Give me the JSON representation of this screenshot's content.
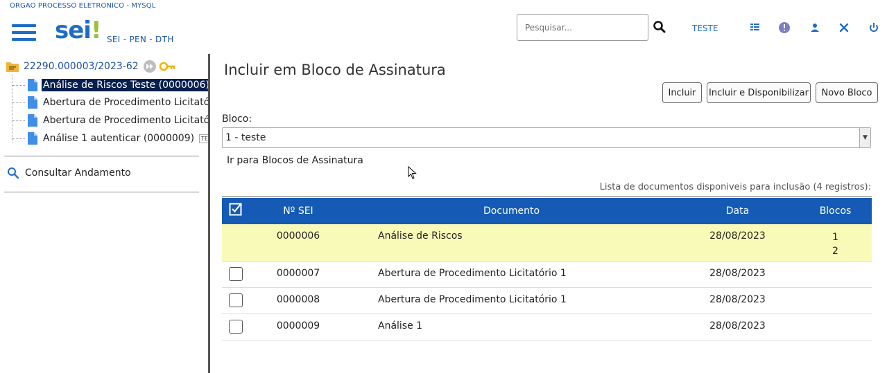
{
  "header": {
    "org_name": "ORGAO PROCESSO ELETRONICO - MYSQL",
    "logo_text": "sei",
    "logo_mark": "!",
    "system_name": "SEI - PEN - DTH",
    "search": {
      "placeholder": "Pesquisar...",
      "value": ""
    },
    "unit": "TESTE",
    "icons": [
      "search-icon",
      "list-icon",
      "info-icon",
      "user-icon",
      "tools-icon",
      "power-icon"
    ],
    "brand_color": "#1f6bc6"
  },
  "tree": {
    "process_number": "22290.000003/2023-62",
    "documents": [
      {
        "label": "Análise de Riscos Teste (0000006)",
        "selected": true,
        "tag": ""
      },
      {
        "label": "Abertura de Procedimento Licitatório",
        "selected": false,
        "tag": ""
      },
      {
        "label": "Abertura de Procedimento Licitatório",
        "selected": false,
        "tag": ""
      },
      {
        "label": "Análise 1 autenticar (0000009)",
        "selected": false,
        "tag": "TESTE"
      }
    ],
    "consult_label": "Consultar Andamento"
  },
  "main": {
    "title": "Incluir em Bloco de Assinatura",
    "buttons": {
      "incluir": "Incluir",
      "incluir_disponibilizar": "Incluir e Disponibilizar",
      "novo_bloco": "Novo Bloco"
    },
    "bloco_label": "Bloco:",
    "bloco_value": "1 - teste",
    "goto_link": "Ir para Blocos de Assinatura",
    "table_caption": "Lista de documentos disponiveis para inclusão (4 registros):",
    "columns": {
      "sei": "Nº SEI",
      "documento": "Documento",
      "data": "Data",
      "blocos": "Blocos"
    },
    "header_color": "#155bb5",
    "highlight_color": "#fafab8",
    "rows": [
      {
        "sei": "0000006",
        "documento": "Análise de Riscos",
        "data": "28/08/2023",
        "blocos": [
          "1",
          "2"
        ],
        "checkbox": false
      },
      {
        "sei": "0000007",
        "documento": "Abertura de Procedimento Licitatório 1",
        "data": "28/08/2023",
        "blocos": [],
        "checkbox": true
      },
      {
        "sei": "0000008",
        "documento": "Abertura de Procedimento Licitatório 1",
        "data": "28/08/2023",
        "blocos": [],
        "checkbox": true
      },
      {
        "sei": "0000009",
        "documento": "Análise 1",
        "data": "28/08/2023",
        "blocos": [],
        "checkbox": true
      }
    ]
  }
}
